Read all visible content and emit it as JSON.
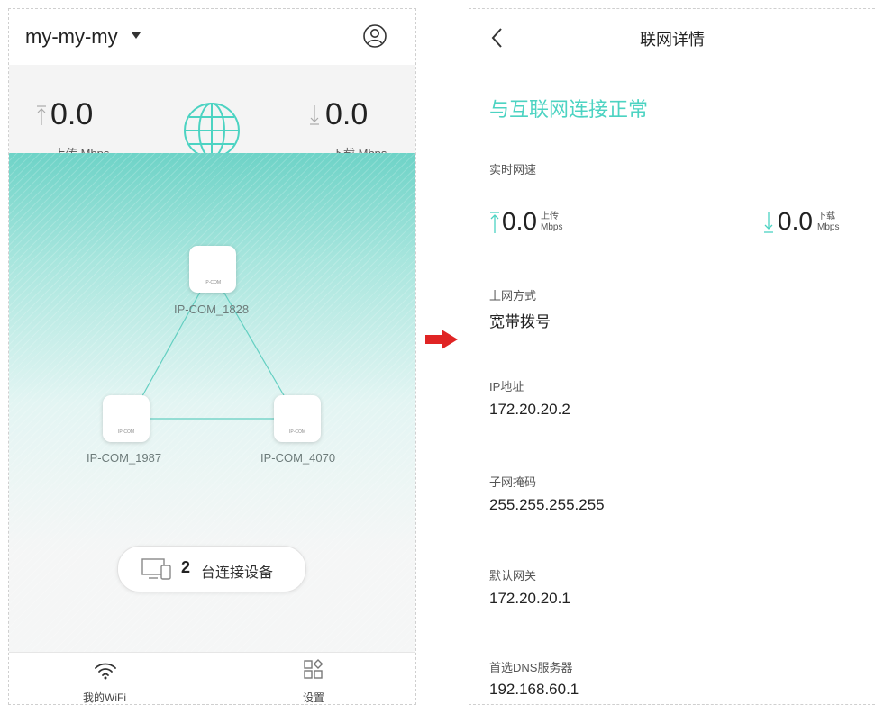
{
  "left": {
    "ssid": "my-my-my",
    "upload": {
      "value": "0.0",
      "unit": "上传 Mbps"
    },
    "download": {
      "value": "0.0",
      "unit": "下载 Mbps"
    },
    "nodes": [
      {
        "brand": "IP-COM",
        "label": "IP-COM_1828"
      },
      {
        "brand": "IP-COM",
        "label": "IP-COM_1987"
      },
      {
        "brand": "IP-COM",
        "label": "IP-COM_4070"
      }
    ],
    "devices": {
      "count": "2",
      "text": "台连接设备"
    },
    "tabs": [
      {
        "label": "我的WiFi"
      },
      {
        "label": "设置"
      }
    ]
  },
  "right": {
    "title": "联网详情",
    "status": "与互联网连接正常",
    "realtime": {
      "label": "实时网速",
      "upload": {
        "value": "0.0",
        "label": "上传",
        "unit": "Mbps"
      },
      "download": {
        "value": "0.0",
        "label": "下载",
        "unit": "Mbps"
      }
    },
    "rows": [
      {
        "label": "上网方式",
        "value": "宽带拨号"
      },
      {
        "label": "IP地址",
        "value": "172.20.20.2"
      },
      {
        "label": "子网掩码",
        "value": "255.255.255.255"
      },
      {
        "label": "默认网关",
        "value": "172.20.20.1"
      },
      {
        "label": "首选DNS服务器",
        "value": "192.168.60.1"
      }
    ]
  },
  "colors": {
    "accent": "#4cd3c2",
    "arrow": "#e02424",
    "teal_bg": "#6ed3c7"
  }
}
